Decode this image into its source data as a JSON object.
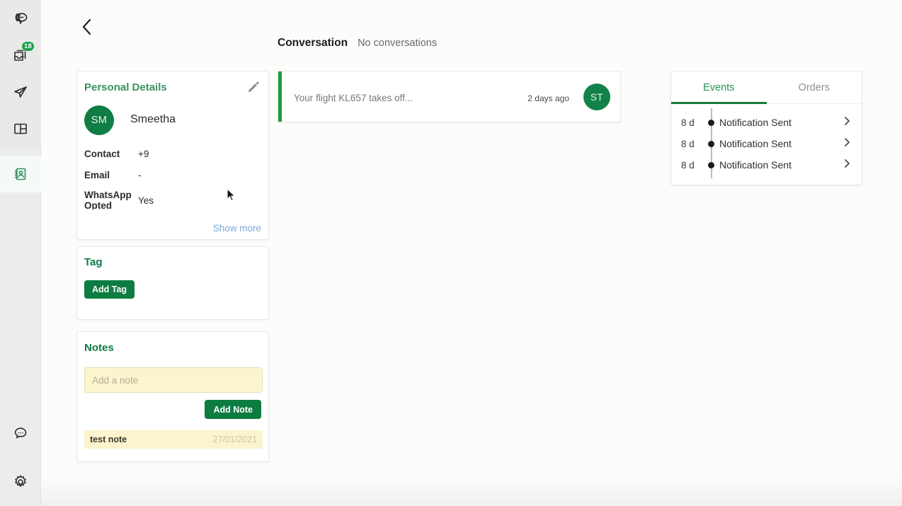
{
  "sidebar": {
    "top_items": [
      {
        "name": "broadcast-icon",
        "label": "Broadcast",
        "badge": null
      },
      {
        "name": "inbox-icon",
        "label": "Inbox",
        "badge": "18"
      },
      {
        "name": "send-icon",
        "label": "Campaigns",
        "badge": null
      },
      {
        "name": "dashboard-icon",
        "label": "Dashboard",
        "badge": null
      }
    ],
    "active_item": {
      "name": "contacts-icon",
      "label": "Contacts"
    },
    "bottom_items": [
      {
        "name": "chat-icon",
        "label": "Support Chat"
      },
      {
        "name": "gear-icon",
        "label": "Settings"
      }
    ]
  },
  "header": {
    "back_icon": "chevron-left-icon",
    "conversation_title": "Conversation",
    "conversation_status": "No conversations"
  },
  "personal_details": {
    "title": "Personal Details",
    "edit_icon": "pencil-icon",
    "avatar_initials": "SM",
    "name": "Smeetha",
    "fields": [
      {
        "label": "Contact",
        "value": "+9"
      },
      {
        "label": "Email",
        "value": "-"
      },
      {
        "label": "WhatsApp Opted",
        "value": "Yes"
      }
    ],
    "show_more": "Show more"
  },
  "tag": {
    "title": "Tag",
    "add_button": "Add Tag"
  },
  "notes": {
    "title": "Notes",
    "input_placeholder": "Add a note",
    "input_value": "",
    "add_button": "Add Note",
    "items": [
      {
        "text": "test note",
        "date": "27/01/2021"
      }
    ]
  },
  "conversation_card": {
    "snippet": "Your flight KL657 takes off...",
    "time_ago": "2 days ago",
    "avatar_initials": "ST"
  },
  "events_panel": {
    "tabs": [
      {
        "label": "Events",
        "active": true
      },
      {
        "label": "Orders",
        "active": false
      }
    ],
    "rows": [
      {
        "age": "8 d",
        "label": "Notification Sent",
        "chevron": "chevron-right-icon"
      },
      {
        "age": "8 d",
        "label": "Notification Sent",
        "chevron": "chevron-right-icon"
      },
      {
        "age": "8 d",
        "label": "Notification Sent",
        "chevron": "chevron-right-icon"
      }
    ]
  },
  "colors": {
    "brand_green": "#0d7c41",
    "accent_green": "#1b9c3f",
    "title_green": "#0f7a43",
    "link_blue": "#7ba7d7",
    "note_yellow": "#fbf4cd"
  }
}
